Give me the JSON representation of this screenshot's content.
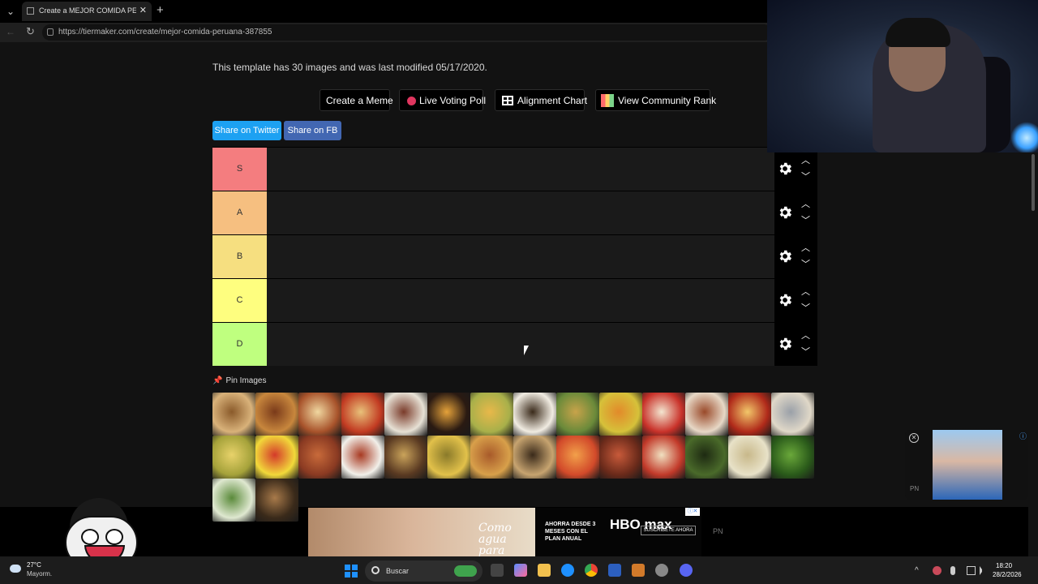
{
  "browser": {
    "tab_title": "Create a MEJOR COMIDA PERUANA",
    "tab_close": "✕",
    "new_tab": "+",
    "url": "https://tiermaker.com/create/mejor-comida-peruana-387855"
  },
  "page": {
    "template_info": "This template has 30 images and was last modified 05/17/2020.",
    "actions": {
      "create_meme": "Create a Meme",
      "live_voting": "Live Voting Poll",
      "alignment_chart": "Alignment Chart",
      "community_rank": "View Community Rank"
    },
    "share": {
      "twitter": "Share on Twitter",
      "facebook": "Share on FB"
    },
    "tiers": [
      {
        "label": "S",
        "color": "#f47d7f"
      },
      {
        "label": "A",
        "color": "#f6bf80"
      },
      {
        "label": "B",
        "color": "#f6df80"
      },
      {
        "label": "C",
        "color": "#fefe7f"
      },
      {
        "label": "D",
        "color": "#bfff7f"
      }
    ],
    "pin_images": "Pin Images"
  },
  "ad": {
    "slogan": "Como agua para Chocolate",
    "price": "AHORRA DESDE 3 MESES CON EL PLAN ANUAL",
    "brand": "HBO max",
    "cta": "SUSCRÍBETE AHORA",
    "pn": "PN"
  },
  "taskbar": {
    "temperature": "27°C",
    "weather_desc": "Mayorm.",
    "search_label": "Buscar",
    "time": "18:20",
    "date": "28/2/2026"
  }
}
